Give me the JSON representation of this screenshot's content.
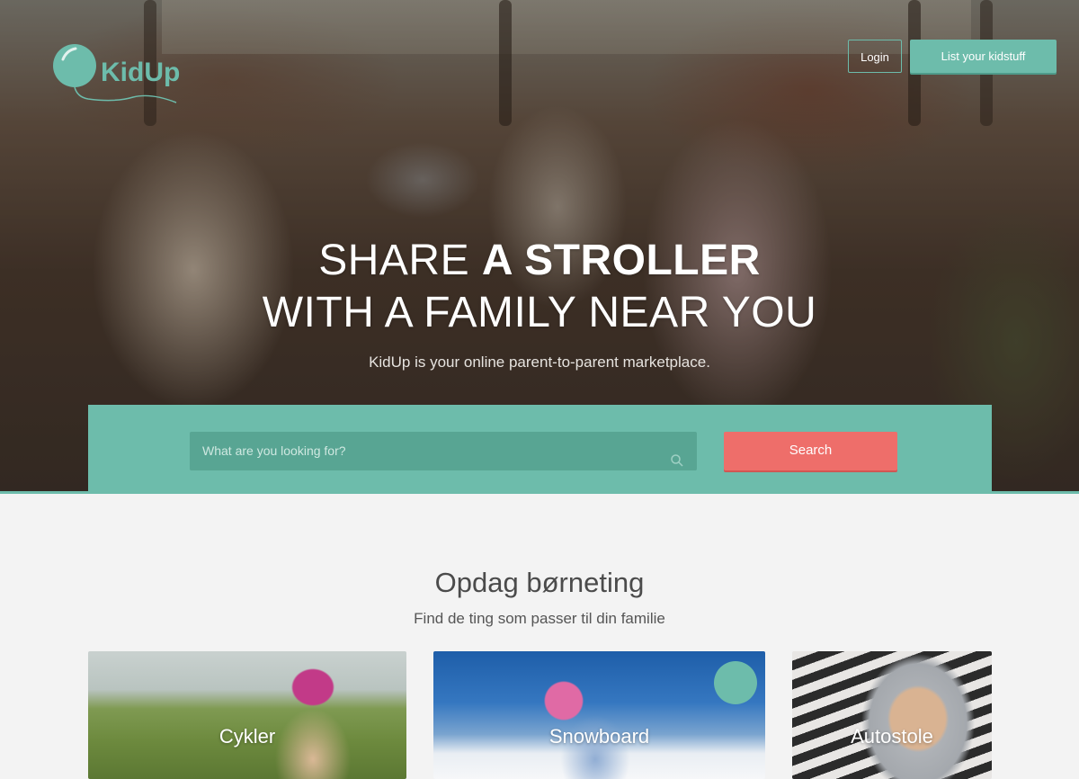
{
  "brand": {
    "name": "KidUp",
    "color": "#6dbcab"
  },
  "nav": {
    "login_label": "Login",
    "list_label": "List your kidstuff"
  },
  "hero": {
    "line1_light": "SHARE ",
    "line1_bold": "A STROLLER",
    "line2": "WITH A FAMILY NEAR YOU",
    "tagline": "KidUp is your online parent-to-parent marketplace."
  },
  "search": {
    "placeholder": "What are you looking for?",
    "button_label": "Search",
    "icon": "search-icon"
  },
  "discover": {
    "title": "Opdag børneting",
    "subtitle": "Find de ting som passer til din familie",
    "categories": [
      {
        "label": "Cykler"
      },
      {
        "label": "Snowboard"
      },
      {
        "label": "Autostole"
      }
    ]
  },
  "colors": {
    "accent": "#6dbcab",
    "search_button": "#ee6e6a",
    "background": "#f3f3f3"
  }
}
